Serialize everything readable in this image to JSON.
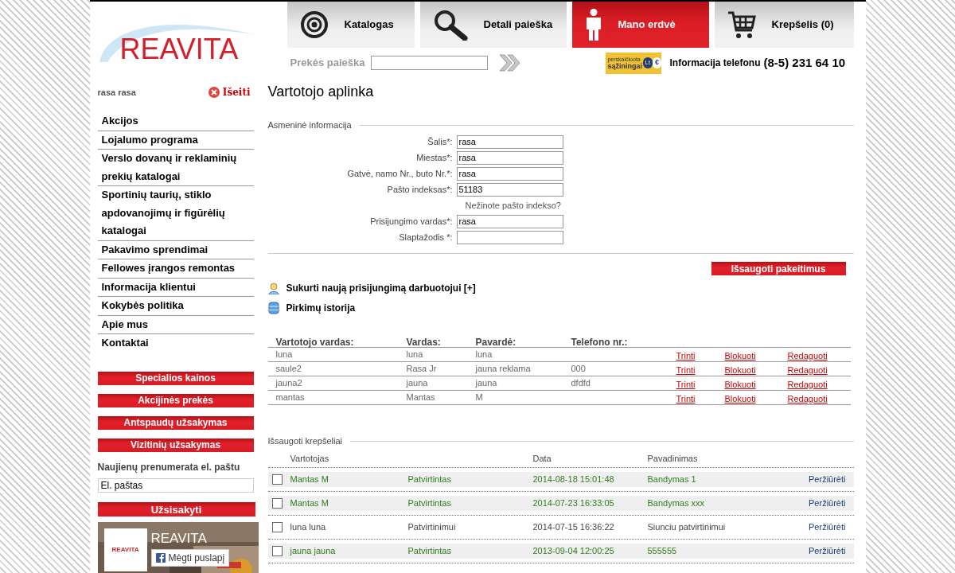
{
  "logo": {
    "text": "REAVITA"
  },
  "nav_tabs": [
    {
      "label": "Katalogas",
      "selected": false
    },
    {
      "label": "Detali paieška",
      "selected": false
    },
    {
      "label": "Mano erdvė",
      "selected": true
    },
    {
      "label": "Krepšelis (0)",
      "selected": false
    }
  ],
  "search": {
    "label": "Prekės paieška"
  },
  "badge": {
    "line_1": "perskaičiuota",
    "line_2": "sąžiningai",
    "currency_1": "Lt",
    "currency_2": "€"
  },
  "phone": {
    "label": "Informacija telefonu",
    "number": "(8-5) 231 64 10"
  },
  "user": {
    "name": "rasa rasa",
    "logout": "Išeiti"
  },
  "sidebar": {
    "items": [
      {
        "label": "Akcijos"
      },
      {
        "label": "Lojalumo programa"
      },
      {
        "label": "Verslo dovanų ir reklaminių prekių katalogai"
      },
      {
        "label": "Sportinių taurių, stiklo apdovanojimų ir figūrėlių katalogai"
      },
      {
        "label": "Pakavimo sprendimai"
      },
      {
        "label": "Fellowes įrangos remontas"
      },
      {
        "label": "Informacija klientui"
      },
      {
        "label": "Kokybės politika"
      },
      {
        "label": "Apie mus"
      },
      {
        "label": "Kontaktai"
      }
    ],
    "buttons": [
      "Specialios kainos",
      "Akcijinės prekės",
      "Antspaudų užsakymas",
      "Vizitinių užsakymas"
    ],
    "newsletter": {
      "label": "Naujienų prenumerata el. paštu",
      "placeholder": "El. paštas",
      "button": "Užsisakyti"
    },
    "facebook": {
      "page_name": "REAVITA",
      "logo_text": "REAVITA",
      "like_button": "Mėgti puslapį"
    }
  },
  "page_title": "Vartotojo aplinka",
  "personal_info": {
    "legend": "Asmeninė informacija",
    "fields": [
      {
        "kind": "input",
        "label": "Šalis*:",
        "value": "rasa"
      },
      {
        "kind": "input",
        "label": "Miestas*:",
        "value": "rasa"
      },
      {
        "kind": "input",
        "label": "Gatvė, namo Nr., buto Nr.*:",
        "value": "rasa"
      },
      {
        "kind": "input",
        "label": "Pašto indeksas*:",
        "value": "51183"
      },
      {
        "kind": "hint",
        "label": "Nežinote pašto indekso?"
      },
      {
        "kind": "input",
        "label": "Prisijungimo vardas*:",
        "value": "rasa"
      },
      {
        "kind": "input",
        "label": "Slaptažodis *:"
      }
    ],
    "save_button": "Išsaugoti pakeitimus"
  },
  "links": [
    {
      "label": "Sukurti naują prisijungimą darbuotojui [+]"
    },
    {
      "label": "Pirkimų istorija"
    }
  ],
  "users_table": {
    "columns": [
      "Vartotojo vardas:",
      "Vardas:",
      "Pavardė:",
      "Telefono nr.:"
    ],
    "rows": [
      {
        "cells": [
          "luna",
          "luna",
          "luna",
          ""
        ],
        "actions": [
          "Trinti",
          "Blokuoti",
          "Redaguoti"
        ]
      },
      {
        "cells": [
          "saule2",
          "Rasa Jr",
          "jauna reklama",
          "000"
        ],
        "actions": [
          "Trinti",
          "Blokuoti",
          "Redaguoti"
        ]
      },
      {
        "cells": [
          "jauna2",
          "jauna",
          "jauna",
          "dfdfd"
        ],
        "actions": [
          "Trinti",
          "Blokuoti",
          "Redaguoti"
        ]
      },
      {
        "cells": [
          "mantas",
          "Mantas",
          "M",
          ""
        ],
        "actions": [
          "Trinti",
          "Blokuoti",
          "Redaguoti"
        ]
      }
    ]
  },
  "saved_carts": {
    "legend": "Išsaugoti krepšeliai",
    "columns": [
      "Vartotojas",
      "Data",
      "Pavadinimas"
    ],
    "rows": [
      {
        "confirmed": true,
        "checked": false,
        "user": "Mantas M",
        "status": "Patvirtintas",
        "date": "2014-08-18 15:01:48",
        "name": "Bandymas 1",
        "action": "Peržiūrėti"
      },
      {
        "confirmed": true,
        "checked": false,
        "user": "Mantas M",
        "status": "Patvirtintas",
        "date": "2014-07-23 16:33:05",
        "name": "Bandymas xxx",
        "action": "Peržiūrėti"
      },
      {
        "confirmed": false,
        "checked": false,
        "user": "luna luna",
        "status": "Patvirtinimui",
        "date": "2014-07-15 16:36:22",
        "name": "Siunciu patvirtinimui",
        "action": "Peržiūrėti"
      },
      {
        "confirmed": true,
        "checked": false,
        "user": "jauna jauna",
        "status": "Patvirtintas",
        "date": "2013-09-04 12:00:25",
        "name": "555555",
        "action": "Peržiūrėti"
      }
    ]
  }
}
